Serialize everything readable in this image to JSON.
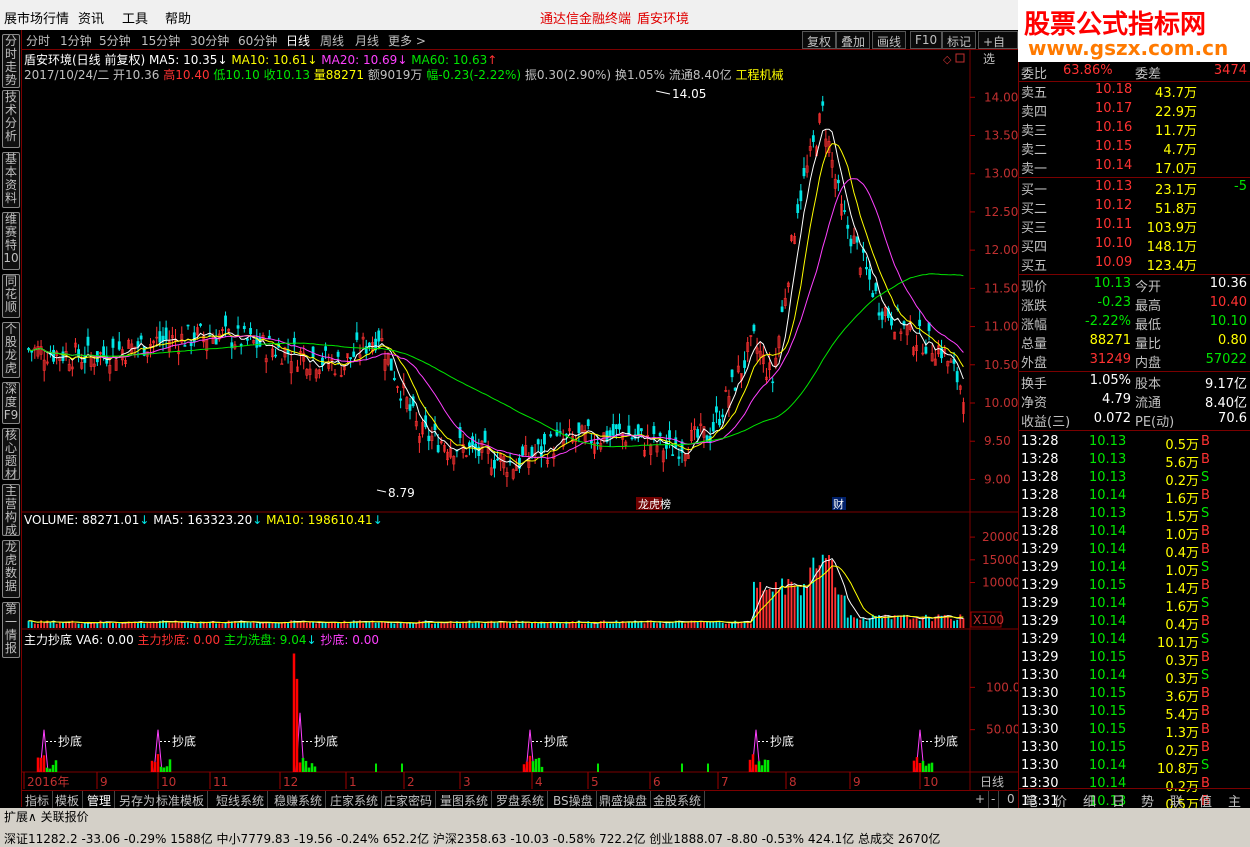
{
  "menubar": {
    "item0": "展市场行情",
    "item1": "资讯",
    "item2": "工具",
    "item3": "帮助",
    "center1": "通达信金融终端",
    "center2": "盾安环境"
  },
  "brand": {
    "line1": "股票公式指标网",
    "line2": "www.gszx.com.cn"
  },
  "left_tabs": [
    "分时走势",
    "技术分析",
    "基本资料",
    "维赛特10",
    "同花顺",
    "个股龙虎",
    "深度F9",
    "核心题材",
    "主营构成",
    "龙虎数据",
    "第一情报"
  ],
  "period_tabs": [
    "分时",
    "1分钟",
    "5分钟",
    "15分钟",
    "30分钟",
    "60分钟",
    "日线",
    "周线",
    "月线",
    "更多 >"
  ],
  "active_period": "日线",
  "tool_buttons": [
    "复权",
    "叠加",
    "画线",
    "F10",
    "标记",
    "+自选"
  ],
  "info": {
    "name": "盾安环境(日线 前复权)",
    "ma5": "MA5: 10.35",
    "ma10": "MA10: 10.61",
    "ma20": "MA20: 10.69",
    "ma60": "MA60: 10.63",
    "date": "2017/10/24/二",
    "open": "开10.36",
    "high": "高10.40",
    "low": "低10.10",
    "close": "收10.13",
    "vol": "量88271",
    "amt": "额9019万",
    "change": "幅-0.23(-2.22%)",
    "amplitude": "振0.30(2.90%)",
    "turnover": "换1.05%",
    "float": "流通8.40亿",
    "industry": "工程机械"
  },
  "price_axis": [
    "14.00",
    "13.50",
    "13.00",
    "12.50",
    "12.00",
    "11.50",
    "11.00",
    "10.50",
    "10.00",
    "9.50",
    "9.00"
  ],
  "price_labels": {
    "high": "14.05",
    "low": "8.79"
  },
  "markers": {
    "m1": "龙虎榜",
    "m2": "财"
  },
  "vol_header": {
    "title": "VOLUME: 88271.01",
    "ma5": "MA5: 163323.20",
    "ma10": "MA10: 198610.41"
  },
  "vol_axis": [
    "20000",
    "15000",
    "10000"
  ],
  "vol_unit": "X100",
  "ind3_header": {
    "name": "主力抄底",
    "va6": "VA6: 0.00",
    "zldi": "主力抄底: 0.00",
    "zlxp": "主力洗盘: 9.04",
    "cd": "抄底: 0.00"
  },
  "ind3_axis": [
    "100.0",
    "50.00"
  ],
  "chaodi_label": "抄底",
  "time_axis": [
    "2016年",
    "9",
    "10",
    "11",
    "12",
    "1",
    "2",
    "3",
    "4",
    "5",
    "6",
    "7",
    "8",
    "9",
    "10"
  ],
  "time_axis_btn": "日线",
  "bottom_tabs": [
    "指标",
    "模板",
    "管理",
    "另存为",
    "标准模板",
    "短线系统",
    "稳赚系统",
    "庄家系统",
    "庄家密码",
    "量图系统",
    "罗盘系统",
    "BS操盘",
    "鼎盛操盘",
    "金股系统"
  ],
  "bottom_right_btns": [
    "+",
    "-",
    "0"
  ],
  "statusbar": {
    "left": "扩展∧  关联报价",
    "line2": "深证11282.2  -33.06  -0.29%  1588亿  中小7779.83  -19.56  -0.24%  652.2亿  沪深2358.63  -10.03  -0.58%  722.2亿  创业1888.07  -8.80  -0.53%  424.1亿  总成交  2670亿"
  },
  "quote": {
    "weibi_label": "委比",
    "weibi": "63.86%",
    "weicha_label": "委差",
    "weicha": "3474",
    "sell": [
      {
        "l": "卖五",
        "p": "10.18",
        "v": "43.7万"
      },
      {
        "l": "卖四",
        "p": "10.17",
        "v": "22.9万"
      },
      {
        "l": "卖三",
        "p": "10.16",
        "v": "11.7万"
      },
      {
        "l": "卖二",
        "p": "10.15",
        "v": "4.7万"
      },
      {
        "l": "卖一",
        "p": "10.14",
        "v": "17.0万"
      }
    ],
    "buy": [
      {
        "l": "买一",
        "p": "10.13",
        "v": "23.1万",
        "x": "-5"
      },
      {
        "l": "买二",
        "p": "10.12",
        "v": "51.8万",
        "x": ""
      },
      {
        "l": "买三",
        "p": "10.11",
        "v": "103.9万",
        "x": ""
      },
      {
        "l": "买四",
        "p": "10.10",
        "v": "148.1万",
        "x": ""
      },
      {
        "l": "买五",
        "p": "10.09",
        "v": "123.4万",
        "x": ""
      }
    ],
    "stats": [
      {
        "l1": "现价",
        "v1": "10.13",
        "c1": "grn",
        "l2": "今开",
        "v2": "10.36",
        "c2": "wht"
      },
      {
        "l1": "涨跌",
        "v1": "-0.23",
        "c1": "grn",
        "l2": "最高",
        "v2": "10.40",
        "c2": "red"
      },
      {
        "l1": "涨幅",
        "v1": "-2.22%",
        "c1": "grn",
        "l2": "最低",
        "v2": "10.10",
        "c2": "grn"
      },
      {
        "l1": "总量",
        "v1": "88271",
        "c1": "yel",
        "l2": "量比",
        "v2": "0.80",
        "c2": "yel"
      },
      {
        "l1": "外盘",
        "v1": "31249",
        "c1": "red",
        "l2": "内盘",
        "v2": "57022",
        "c2": "grn"
      }
    ],
    "stats2": [
      {
        "l1": "换手",
        "v1": "1.05%",
        "l2": "股本",
        "v2": "9.17亿"
      },
      {
        "l1": "净资",
        "v1": "4.79",
        "l2": "流通",
        "v2": "8.40亿"
      },
      {
        "l1": "收益(三)",
        "v1": "0.072",
        "l2": "PE(动)",
        "v2": "70.6"
      }
    ],
    "ticks": [
      {
        "t": "13:28",
        "p": "10.13",
        "v": "0.5万",
        "s": "B"
      },
      {
        "t": "13:28",
        "p": "10.13",
        "v": "5.6万",
        "s": "B"
      },
      {
        "t": "13:28",
        "p": "10.13",
        "v": "0.2万",
        "s": "S"
      },
      {
        "t": "13:28",
        "p": "10.14",
        "v": "1.6万",
        "s": "B"
      },
      {
        "t": "13:28",
        "p": "10.13",
        "v": "1.5万",
        "s": "S"
      },
      {
        "t": "13:28",
        "p": "10.14",
        "v": "1.0万",
        "s": "B"
      },
      {
        "t": "13:29",
        "p": "10.14",
        "v": "0.4万",
        "s": "B"
      },
      {
        "t": "13:29",
        "p": "10.14",
        "v": "1.0万",
        "s": "S"
      },
      {
        "t": "13:29",
        "p": "10.15",
        "v": "1.4万",
        "s": "B"
      },
      {
        "t": "13:29",
        "p": "10.14",
        "v": "1.6万",
        "s": "S"
      },
      {
        "t": "13:29",
        "p": "10.14",
        "v": "0.4万",
        "s": "B"
      },
      {
        "t": "13:29",
        "p": "10.14",
        "v": "10.1万",
        "s": "S"
      },
      {
        "t": "13:29",
        "p": "10.15",
        "v": "0.3万",
        "s": "B"
      },
      {
        "t": "13:30",
        "p": "10.14",
        "v": "0.3万",
        "s": "S"
      },
      {
        "t": "13:30",
        "p": "10.15",
        "v": "3.6万",
        "s": "B"
      },
      {
        "t": "13:30",
        "p": "10.15",
        "v": "5.4万",
        "s": "B"
      },
      {
        "t": "13:30",
        "p": "10.15",
        "v": "1.3万",
        "s": "B"
      },
      {
        "t": "13:30",
        "p": "10.15",
        "v": "0.2万",
        "s": "B"
      },
      {
        "t": "13:30",
        "p": "10.14",
        "v": "10.8万",
        "s": "S"
      },
      {
        "t": "13:30",
        "p": "10.14",
        "v": "0.2万",
        "s": "B"
      },
      {
        "t": "13:31",
        "p": "10.13",
        "v": "0.5万",
        "s": "B"
      }
    ],
    "bottom_tabs": [
      "笔",
      "价",
      "细",
      "日",
      "势",
      "联",
      "值",
      "主"
    ]
  },
  "colors": {
    "up": "#ff3232",
    "down": "#00e6e6",
    "ma5": "#ffffff",
    "ma10": "#ffff00",
    "ma20": "#ff40ff",
    "ma60": "#00e600",
    "frame": "#7a0000"
  }
}
